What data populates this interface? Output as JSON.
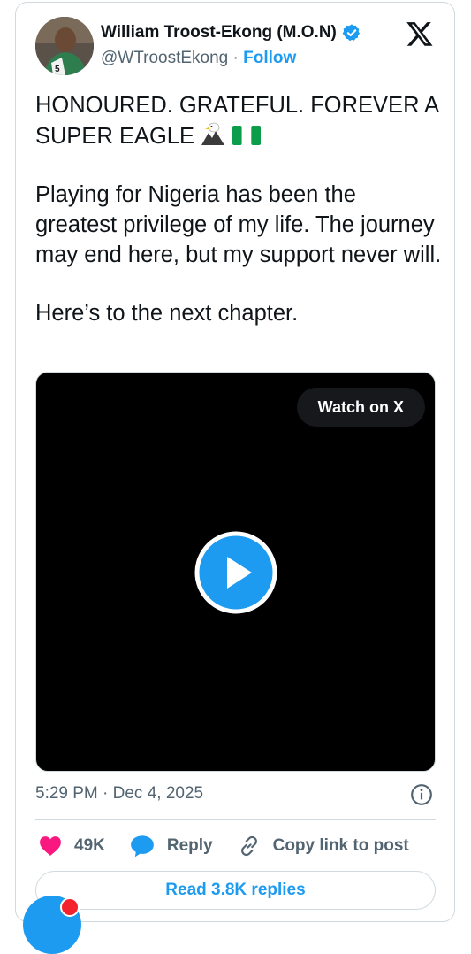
{
  "author": {
    "name": "William Troost-Ekong (M.O.N)",
    "handle": "@WTroostEkong",
    "separator": "·",
    "follow_label": "Follow",
    "avatar_jersey_number": "5"
  },
  "tweet": {
    "line1": "HONOURED. GRATEFUL. FOREVER A SUPER EAGLE",
    "paragraph2": "Playing for Nigeria has been the greatest privilege of my life. The journey may end here, but my support never will.",
    "paragraph3": "Here’s to the next chapter."
  },
  "video": {
    "watch_label": "Watch on X"
  },
  "meta": {
    "timestamp": "5:29 PM · Dec 4, 2025"
  },
  "actions": {
    "likes": "49K",
    "reply_label": "Reply",
    "copy_label": "Copy link to post"
  },
  "replies_button": "Read 3.8K replies",
  "colors": {
    "accent": "#1d9bf0",
    "like": "#f91880",
    "muted": "#536471",
    "border": "#cfd9de"
  },
  "icons": [
    "verified-badge-icon",
    "x-logo-icon",
    "eagle-emoji-icon",
    "nigeria-flag-icon",
    "play-icon",
    "info-icon",
    "heart-icon",
    "reply-bubble-icon",
    "link-icon"
  ]
}
